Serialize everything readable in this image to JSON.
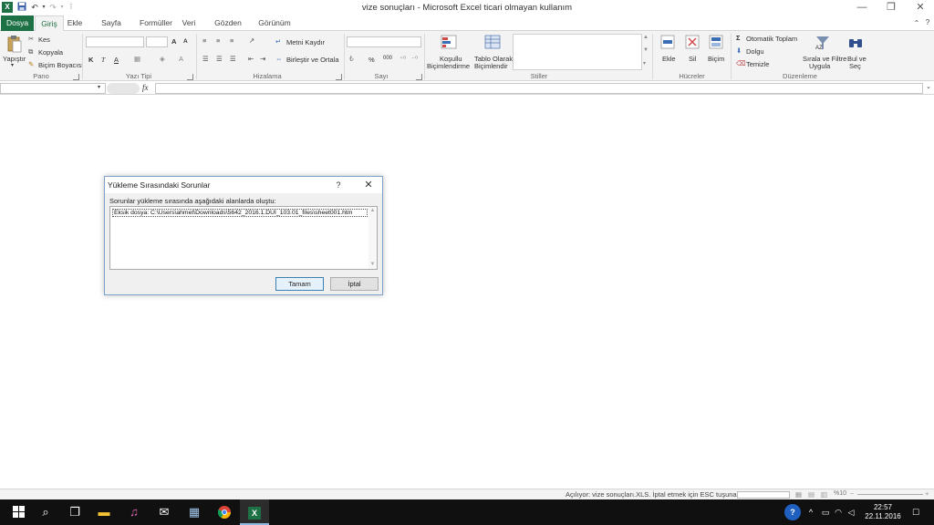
{
  "window": {
    "title": "vize sonuçları  -  Microsoft Excel ticari olmayan kullanım",
    "controls": [
      "minimize-icon",
      "restore-icon",
      "close-icon"
    ]
  },
  "qat": {
    "icons": [
      "excel-logo-icon",
      "save-icon",
      "undo-icon",
      "redo-icon",
      "customize-icon"
    ]
  },
  "tabs": [
    {
      "label": "Dosya"
    },
    {
      "label": "Giriş"
    },
    {
      "label": "Ekle"
    },
    {
      "label": "Sayfa Düzeni"
    },
    {
      "label": "Formüller"
    },
    {
      "label": "Veri"
    },
    {
      "label": "Gözden Geçir"
    },
    {
      "label": "Görünüm"
    }
  ],
  "ribbon": {
    "clipboard": {
      "paste": "Yapıştır",
      "cut": "Kes",
      "copy": "Kopyala",
      "format_painter": "Biçim Boyacısı",
      "label": "Pano"
    },
    "font": {
      "bold": "K",
      "italic": "T",
      "underline": "A",
      "grow": "A",
      "shrink": "A",
      "label": "Yazı Tipi"
    },
    "alignment": {
      "wrap": "Metni Kaydır",
      "merge": "Birleştir ve Ortala",
      "label": "Hizalama"
    },
    "number": {
      "percent": "%",
      "comma": "000",
      "label": "Sayı"
    },
    "styles": {
      "conditional": [
        "Koşullu",
        "Biçimlendirme"
      ],
      "table": [
        "Tablo Olarak",
        "Biçimlendir"
      ],
      "label": "Stiller"
    },
    "cells": {
      "insert": "Ekle",
      "delete": "Sil",
      "format": "Biçim",
      "label": "Hücreler"
    },
    "editing": {
      "autosum": "Otomatik Toplam",
      "fill": "Dolgu",
      "clear": "Temizle",
      "sort": [
        "Sırala ve Filtre",
        "Uygula"
      ],
      "find": [
        "Bul ve",
        "Seç"
      ],
      "label": "Düzenleme"
    }
  },
  "formula_bar": {
    "fx": "fx",
    "name_box": ""
  },
  "dialog": {
    "title": "Yükleme Sırasındaki Sorunlar",
    "help": "?",
    "close": "✕",
    "message": "Sorunlar yükleme sırasında aşağıdaki alanlarda oluştu:",
    "items": [
      "Eksik dosya:  C:\\Users\\ahmet\\Downloads\\5642_2016.1.DUI_103.01_files\\sheet001.htm"
    ],
    "ok": "Tamam",
    "cancel": "İptal"
  },
  "status": {
    "text": "Açılıyor: vize sonuçları.XLS. İptal etmek için ESC tuşuna basın",
    "zoom": "%10"
  },
  "taskbar": {
    "icons": [
      "windows-start-icon",
      "search-icon",
      "task-view-icon",
      "file-explorer-icon",
      "itunes-icon",
      "mail-icon",
      "store-icon",
      "chrome-icon",
      "excel-icon"
    ],
    "time": "22:57",
    "date": "22.11.2016"
  },
  "colors": {
    "excel_green": "#1e7145",
    "ribbon_bg": "#f3f3f3",
    "taskbar": "#101010"
  }
}
